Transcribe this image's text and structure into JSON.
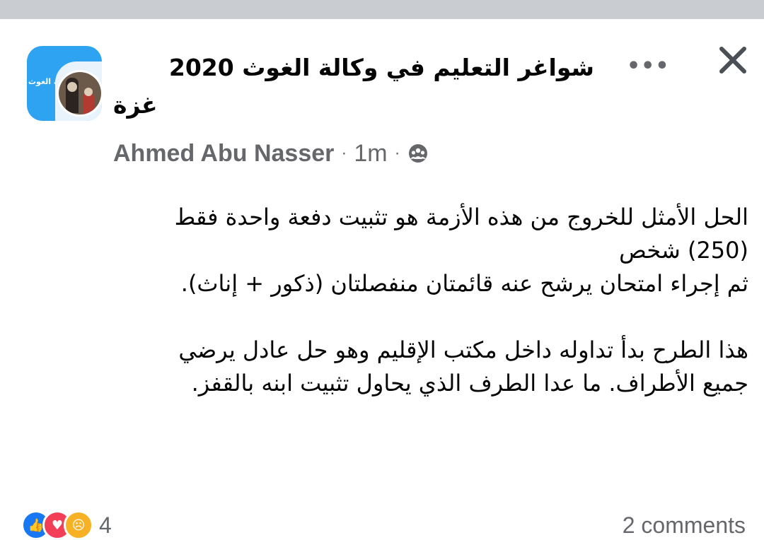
{
  "header": {
    "group_name_line1": "شواغر التعليم في وكالة الغوث 2020",
    "group_name_line2": "غزة",
    "group_avatar_text": "وكالة الغوث",
    "author": "Ahmed Abu Nasser",
    "time": "1m",
    "privacy_icon": "group-members-icon",
    "more_icon": "more-dots-icon",
    "close_icon": "close-icon"
  },
  "post": {
    "line1": "الحل الأمثل للخروج من هذه الأزمة هو تثبيت دفعة واحدة فقط",
    "line2": "(250) شخص",
    "line3": "ثم إجراء امتحان يرشح عنه قائمتان منفصلتان (ذكور + إناث).",
    "line4": "هذا الطرح بدأ تداوله داخل مكتب الإقليم وهو حل عادل يرضي",
    "line5": "جميع الأطراف. ما عدا الطرف الذي يحاول تثبيت ابنه بالقفز."
  },
  "footer": {
    "reaction_count": "4",
    "reactions": [
      "like",
      "love",
      "sad"
    ],
    "comments": "2 comments"
  },
  "colors": {
    "top_strip": "#c9ccd1",
    "group_avatar_bg": "#2ea3f2",
    "meta_text": "#65676b",
    "like": "#1877f2",
    "love": "#f33e58",
    "sad": "#f7b125"
  }
}
